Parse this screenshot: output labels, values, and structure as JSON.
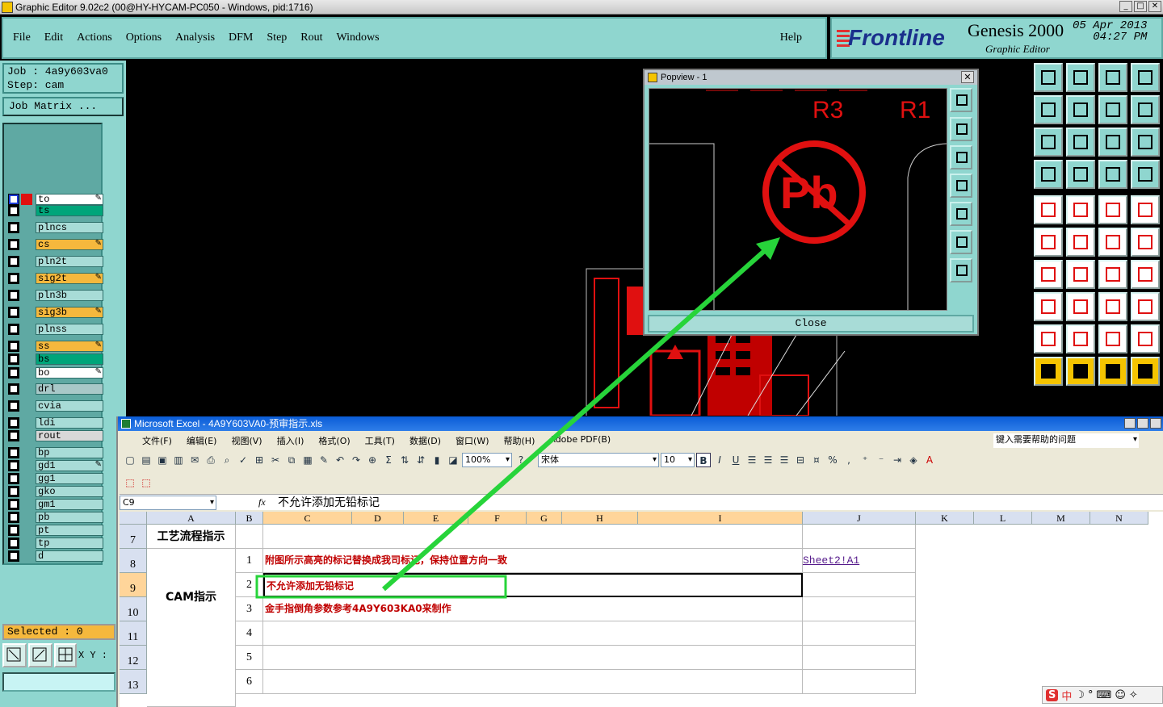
{
  "window": {
    "title": "Graphic Editor 9.02c2 (00@HY-HYCAM-PC050 - Windows, pid:1716)"
  },
  "menu": {
    "items": [
      "File",
      "Edit",
      "Actions",
      "Options",
      "Analysis",
      "DFM",
      "Step",
      "Rout",
      "Windows"
    ],
    "help": "Help"
  },
  "brand": {
    "logo": "Frontline",
    "product": "Genesis 2000",
    "subtitle": "Graphic Editor",
    "date": "05 Apr 2013",
    "time": "04:27 PM"
  },
  "job": {
    "job": "Job : 4a9y603va0",
    "step": "Step: cam",
    "matrix_button": "Job Matrix ..."
  },
  "layers": [
    {
      "name": "to",
      "color": "#ffffff",
      "edit": true
    },
    {
      "name": "ts",
      "color": "#00a57a",
      "edit": false
    },
    {
      "name": "plncs",
      "color": "#a8dcd7",
      "edit": false
    },
    {
      "name": "cs",
      "color": "#f5b83d",
      "edit": true
    },
    {
      "name": "pln2t",
      "color": "#a8dcd7",
      "edit": false
    },
    {
      "name": "sig2t",
      "color": "#f5b83d",
      "edit": true
    },
    {
      "name": "pln3b",
      "color": "#a8dcd7",
      "edit": false
    },
    {
      "name": "sig3b",
      "color": "#f5b83d",
      "edit": true
    },
    {
      "name": "plnss",
      "color": "#a8dcd7",
      "edit": false
    },
    {
      "name": "ss",
      "color": "#f5b83d",
      "edit": true
    },
    {
      "name": "bs",
      "color": "#00a57a",
      "edit": false
    },
    {
      "name": "bo",
      "color": "#ffffff",
      "edit": true
    },
    {
      "name": "drl",
      "color": "#a8c8c8",
      "edit": false
    },
    {
      "name": "cvia",
      "color": "#a8dcd7",
      "edit": false
    },
    {
      "name": "ldi",
      "color": "#a8dcd7",
      "edit": false
    },
    {
      "name": "rout",
      "color": "#d8d8d8",
      "edit": false
    },
    {
      "name": "bp",
      "color": "#a8dcd7",
      "edit": false
    },
    {
      "name": "gd1",
      "color": "#a8dcd7",
      "edit": true
    },
    {
      "name": "gg1",
      "color": "#a8dcd7",
      "edit": false
    },
    {
      "name": "gko",
      "color": "#a8dcd7",
      "edit": false
    },
    {
      "name": "gm1",
      "color": "#a8dcd7",
      "edit": false
    },
    {
      "name": "pb",
      "color": "#a8dcd7",
      "edit": false
    },
    {
      "name": "pt",
      "color": "#a8dcd7",
      "edit": false
    },
    {
      "name": "tp",
      "color": "#a8dcd7",
      "edit": false
    },
    {
      "name": "d",
      "color": "#a8dcd7",
      "edit": false
    }
  ],
  "status": {
    "selected": "Selected : 0",
    "xy": "X Y :"
  },
  "popview": {
    "title": "Popview - 1",
    "close": "Close",
    "labels": [
      "R3",
      "R1",
      "Pb"
    ]
  },
  "excel": {
    "title": "Microsoft Excel - 4A9Y603VA0-预审指示.xls",
    "menu": [
      "文件(F)",
      "编辑(E)",
      "视图(V)",
      "插入(I)",
      "格式(O)",
      "工具(T)",
      "数据(D)",
      "窗口(W)",
      "帮助(H)",
      "Adobe PDF(B)"
    ],
    "help_box": "键入需要帮助的问题",
    "zoom": "100%",
    "font": "宋体",
    "size": "10",
    "name_box": "C9",
    "formula": "不允许添加无铅标记",
    "columns": [
      "A",
      "B",
      "C",
      "D",
      "E",
      "F",
      "G",
      "H",
      "I",
      "J",
      "K",
      "L",
      "M",
      "N"
    ],
    "rows": [
      {
        "num": "7",
        "a": "工艺流程指示",
        "b": "",
        "c": "",
        "j": ""
      },
      {
        "num": "8",
        "a": "",
        "b": "1",
        "c": "附图所示高亮的标记替换成我司标记，保持位置方向一致",
        "j": "Sheet2!A1"
      },
      {
        "num": "9",
        "a": "",
        "b": "2",
        "c": "不允许添加无铅标记",
        "j": ""
      },
      {
        "num": "10",
        "a": "",
        "b": "3",
        "c": "金手指倒角参数参考4A9Y603KA0来制作",
        "j": ""
      },
      {
        "num": "11",
        "a": "CAM指示",
        "b": "4",
        "c": "",
        "j": ""
      },
      {
        "num": "12",
        "a": "",
        "b": "5",
        "c": "",
        "j": ""
      },
      {
        "num": "13",
        "a": "",
        "b": "6",
        "c": "",
        "j": ""
      }
    ],
    "ime": "中"
  },
  "colors": {
    "panel": "#8fd6cf",
    "highlight": "#27d43a",
    "pcb_red": "#e01010"
  }
}
